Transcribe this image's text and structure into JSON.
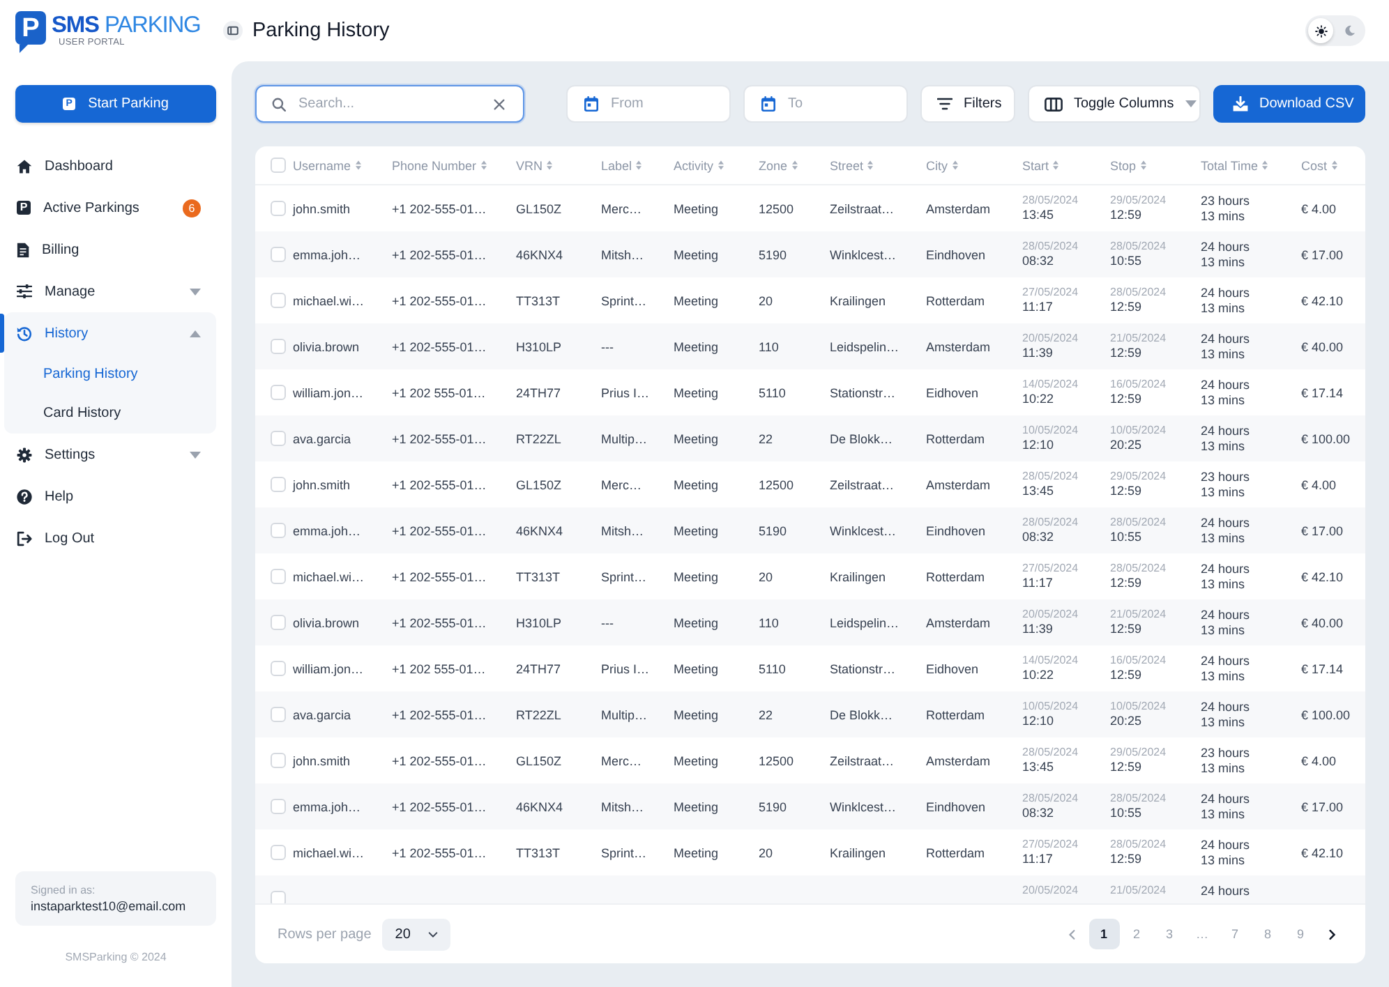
{
  "sidebar": {
    "logo": {
      "mark": "P",
      "brand": "**SMS** PARKING",
      "subtitle": "USER PORTAL"
    },
    "start_button": {
      "label": "Start Parking",
      "icon_text": "P"
    },
    "nav": [
      {
        "label": "Dashboard",
        "selected": false
      },
      {
        "label": "Active Parkings",
        "selected": false,
        "icon_text": "P",
        "badge": "6"
      },
      {
        "label": "Billing",
        "selected": false
      },
      {
        "label": "Manage",
        "selected": false,
        "expanded": false
      },
      {
        "label": "History",
        "selected": true,
        "expanded": true,
        "children": [
          {
            "label": "Parking History",
            "selected": true
          },
          {
            "label": "Card History",
            "selected": false
          }
        ]
      },
      {
        "label": "Settings",
        "selected": false,
        "expanded": false
      },
      {
        "label": "Help",
        "selected": false
      },
      {
        "label": "Log Out",
        "selected": false
      }
    ],
    "user": {
      "caption": "Signed in as:",
      "email": "instaparktest10@email.com"
    },
    "copyright": "SMSParking © 2024"
  },
  "header": {
    "title": "Parking History",
    "theme_toggle": {
      "dark": false
    }
  },
  "toolbar": {
    "search": {
      "placeholder": "Search...",
      "focused": true
    },
    "date_fields": [
      {
        "placeholder": "From"
      },
      {
        "placeholder": "To"
      }
    ],
    "buttons": [
      {
        "label": "Filters",
        "kind": "plain"
      },
      {
        "label": "Toggle Columns",
        "kind": "dropdown"
      },
      {
        "label": "Download CSV",
        "kind": "primary"
      }
    ]
  },
  "table": {
    "select_all": {
      "checked": false
    },
    "columns": [
      {
        "label": "Username"
      },
      {
        "label": "Phone Number"
      },
      {
        "label": "VRN"
      },
      {
        "label": "Label"
      },
      {
        "label": "Activity"
      },
      {
        "label": "Zone"
      },
      {
        "label": "Street"
      },
      {
        "label": "City"
      },
      {
        "label": "Start"
      },
      {
        "label": "Stop"
      },
      {
        "label": "Total Time"
      },
      {
        "label": "Cost"
      }
    ],
    "rows": [
      {
        "checked": false,
        "username": "john.smith",
        "phone": "+1 202-555-01…",
        "vrn": "GL150Z",
        "label": "Merc…",
        "activity": "Meeting",
        "zone": "12500",
        "street": "Zeilstraat…",
        "city": "Amsterdam",
        "start": {
          "date": "28/05/2024",
          "time": "13:45"
        },
        "stop": {
          "date": "29/05/2024",
          "time": "12:59"
        },
        "total": [
          "23 hours",
          "13 mins"
        ],
        "cost": "€ 4.00"
      },
      {
        "checked": false,
        "username": "emma.joh…",
        "phone": "+1 202-555-01…",
        "vrn": "46KNX4",
        "label": "Mitsh…",
        "activity": "Meeting",
        "zone": "5190",
        "street": "Winklcest…",
        "city": "Eindhoven",
        "start": {
          "date": "28/05/2024",
          "time": "08:32"
        },
        "stop": {
          "date": "28/05/2024",
          "time": "10:55"
        },
        "total": [
          "24 hours",
          "13 mins"
        ],
        "cost": "€ 17.00"
      },
      {
        "checked": false,
        "username": "michael.wi…",
        "phone": "+1 202-555-01…",
        "vrn": "TT313T",
        "label": "Sprint…",
        "activity": "Meeting",
        "zone": "20",
        "street": "Krailingen",
        "city": "Rotterdam",
        "start": {
          "date": "27/05/2024",
          "time": "11:17"
        },
        "stop": {
          "date": "28/05/2024",
          "time": "12:59"
        },
        "total": [
          "24 hours",
          "13 mins"
        ],
        "cost": "€ 42.10"
      },
      {
        "checked": false,
        "username": "olivia.brown",
        "phone": "+1 202-555-01…",
        "vrn": "H310LP",
        "label": "---",
        "activity": "Meeting",
        "zone": "110",
        "street": "Leidspelin…",
        "city": "Amsterdam",
        "start": {
          "date": "20/05/2024",
          "time": "11:39"
        },
        "stop": {
          "date": "21/05/2024",
          "time": "12:59"
        },
        "total": [
          "24 hours",
          "13 mins"
        ],
        "cost": "€ 40.00"
      },
      {
        "checked": false,
        "username": "william.jon…",
        "phone": "+1 202 555-01…",
        "vrn": "24TH77",
        "label": "Prius I…",
        "activity": "Meeting",
        "zone": "5110",
        "street": "Stationstr…",
        "city": "Eidhoven",
        "start": {
          "date": "14/05/2024",
          "time": "10:22"
        },
        "stop": {
          "date": "16/05/2024",
          "time": "12:59"
        },
        "total": [
          "24 hours",
          "13 mins"
        ],
        "cost": "€ 17.14"
      },
      {
        "checked": false,
        "username": "ava.garcia",
        "phone": "+1 202-555-01…",
        "vrn": "RT22ZL",
        "label": "Multip…",
        "activity": "Meeting",
        "zone": "22",
        "street": "De Blokk…",
        "city": "Rotterdam",
        "start": {
          "date": "10/05/2024",
          "time": "12:10"
        },
        "stop": {
          "date": "10/05/2024",
          "time": "20:25"
        },
        "total": [
          "24 hours",
          "13 mins"
        ],
        "cost": "€ 100.00"
      },
      {
        "checked": false,
        "username": "john.smith",
        "phone": "+1 202-555-01…",
        "vrn": "GL150Z",
        "label": "Merc…",
        "activity": "Meeting",
        "zone": "12500",
        "street": "Zeilstraat…",
        "city": "Amsterdam",
        "start": {
          "date": "28/05/2024",
          "time": "13:45"
        },
        "stop": {
          "date": "29/05/2024",
          "time": "12:59"
        },
        "total": [
          "23 hours",
          "13 mins"
        ],
        "cost": "€ 4.00"
      },
      {
        "checked": false,
        "username": "emma.joh…",
        "phone": "+1 202-555-01…",
        "vrn": "46KNX4",
        "label": "Mitsh…",
        "activity": "Meeting",
        "zone": "5190",
        "street": "Winklcest…",
        "city": "Eindhoven",
        "start": {
          "date": "28/05/2024",
          "time": "08:32"
        },
        "stop": {
          "date": "28/05/2024",
          "time": "10:55"
        },
        "total": [
          "24 hours",
          "13 mins"
        ],
        "cost": "€ 17.00"
      },
      {
        "checked": false,
        "username": "michael.wi…",
        "phone": "+1 202-555-01…",
        "vrn": "TT313T",
        "label": "Sprint…",
        "activity": "Meeting",
        "zone": "20",
        "street": "Krailingen",
        "city": "Rotterdam",
        "start": {
          "date": "27/05/2024",
          "time": "11:17"
        },
        "stop": {
          "date": "28/05/2024",
          "time": "12:59"
        },
        "total": [
          "24 hours",
          "13 mins"
        ],
        "cost": "€ 42.10"
      },
      {
        "checked": false,
        "username": "olivia.brown",
        "phone": "+1 202-555-01…",
        "vrn": "H310LP",
        "label": "---",
        "activity": "Meeting",
        "zone": "110",
        "street": "Leidspelin…",
        "city": "Amsterdam",
        "start": {
          "date": "20/05/2024",
          "time": "11:39"
        },
        "stop": {
          "date": "21/05/2024",
          "time": "12:59"
        },
        "total": [
          "24 hours",
          "13 mins"
        ],
        "cost": "€ 40.00"
      },
      {
        "checked": false,
        "username": "william.jon…",
        "phone": "+1 202 555-01…",
        "vrn": "24TH77",
        "label": "Prius I…",
        "activity": "Meeting",
        "zone": "5110",
        "street": "Stationstr…",
        "city": "Eidhoven",
        "start": {
          "date": "14/05/2024",
          "time": "10:22"
        },
        "stop": {
          "date": "16/05/2024",
          "time": "12:59"
        },
        "total": [
          "24 hours",
          "13 mins"
        ],
        "cost": "€ 17.14"
      },
      {
        "checked": false,
        "username": "ava.garcia",
        "phone": "+1 202-555-01…",
        "vrn": "RT22ZL",
        "label": "Multip…",
        "activity": "Meeting",
        "zone": "22",
        "street": "De Blokk…",
        "city": "Rotterdam",
        "start": {
          "date": "10/05/2024",
          "time": "12:10"
        },
        "stop": {
          "date": "10/05/2024",
          "time": "20:25"
        },
        "total": [
          "24 hours",
          "13 mins"
        ],
        "cost": "€ 100.00"
      },
      {
        "checked": false,
        "username": "john.smith",
        "phone": "+1 202-555-01…",
        "vrn": "GL150Z",
        "label": "Merc…",
        "activity": "Meeting",
        "zone": "12500",
        "street": "Zeilstraat…",
        "city": "Amsterdam",
        "start": {
          "date": "28/05/2024",
          "time": "13:45"
        },
        "stop": {
          "date": "29/05/2024",
          "time": "12:59"
        },
        "total": [
          "23 hours",
          "13 mins"
        ],
        "cost": "€ 4.00"
      },
      {
        "checked": false,
        "username": "emma.joh…",
        "phone": "+1 202-555-01…",
        "vrn": "46KNX4",
        "label": "Mitsh…",
        "activity": "Meeting",
        "zone": "5190",
        "street": "Winklcest…",
        "city": "Eindhoven",
        "start": {
          "date": "28/05/2024",
          "time": "08:32"
        },
        "stop": {
          "date": "28/05/2024",
          "time": "10:55"
        },
        "total": [
          "24 hours",
          "13 mins"
        ],
        "cost": "€ 17.00"
      },
      {
        "checked": false,
        "username": "michael.wi…",
        "phone": "+1 202-555-01…",
        "vrn": "TT313T",
        "label": "Sprint…",
        "activity": "Meeting",
        "zone": "20",
        "street": "Krailingen",
        "city": "Rotterdam",
        "start": {
          "date": "27/05/2024",
          "time": "11:17"
        },
        "stop": {
          "date": "28/05/2024",
          "time": "12:59"
        },
        "total": [
          "24 hours",
          "13 mins"
        ],
        "cost": "€ 42.10"
      },
      {
        "checked": false,
        "start": {
          "date": "20/05/2024"
        },
        "stop": {
          "date": "21/05/2024"
        },
        "total": [
          "24 hours"
        ]
      }
    ]
  },
  "footer": {
    "rows_per_page": {
      "label": "Rows per page",
      "value": "20"
    },
    "pages": [
      {
        "label": "1",
        "kind": "page",
        "selected": true
      },
      {
        "label": "2",
        "kind": "page",
        "selected": false
      },
      {
        "label": "3",
        "kind": "page",
        "selected": false
      },
      {
        "label": "…",
        "kind": "ellipsis"
      },
      {
        "label": "7",
        "kind": "page",
        "selected": false
      },
      {
        "label": "8",
        "kind": "page",
        "selected": false
      },
      {
        "label": "9",
        "kind": "page",
        "selected": false
      }
    ]
  }
}
